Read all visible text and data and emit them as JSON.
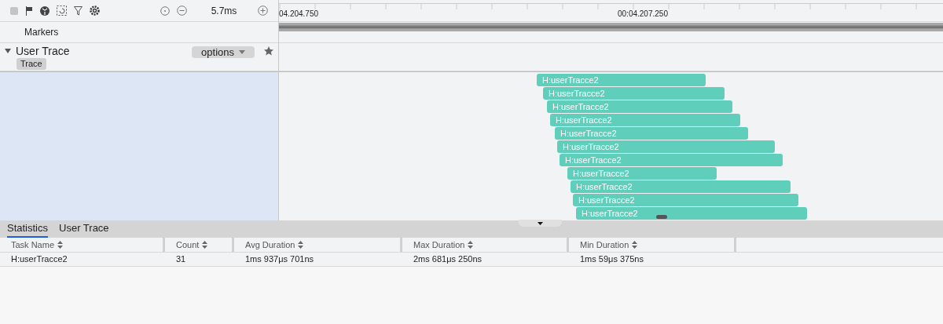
{
  "toolbar": {
    "zoom_value": "5.7ms"
  },
  "ruler": {
    "labels": [
      "04.204.750",
      "00:04.207.250"
    ]
  },
  "markers_row": {
    "label": "Markers"
  },
  "track": {
    "title": "User Trace",
    "expanded": true,
    "tag": "Trace",
    "options": "options"
  },
  "slices": [
    {
      "label": "H:userTracce2"
    },
    {
      "label": "H:userTracce2"
    },
    {
      "label": "H:userTracce2"
    },
    {
      "label": "H:userTracce2"
    },
    {
      "label": "H:userTracce2"
    },
    {
      "label": "H:userTracce2"
    },
    {
      "label": "H:userTracce2"
    },
    {
      "label": "H:userTracce2"
    },
    {
      "label": "H:userTracce2"
    },
    {
      "label": "H:userTracce2"
    },
    {
      "label": "H:userTracce2"
    }
  ],
  "tabs": [
    {
      "label": "Statistics",
      "selected": true
    },
    {
      "label": "User Trace",
      "selected": false
    }
  ],
  "table": {
    "columns": [
      "Task Name",
      "Count",
      "Avg Duration",
      "Max Duration",
      "Min Duration"
    ],
    "rows": [
      [
        "H:userTracce2",
        "31",
        "1ms 937μs 701ns",
        "2ms 681μs 250ns",
        "1ms 59μs 375ns"
      ]
    ]
  }
}
